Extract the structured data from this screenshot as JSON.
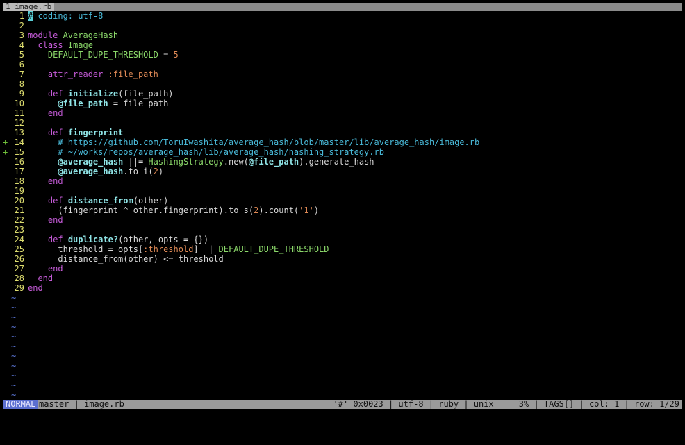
{
  "tab": {
    "label": "1 image.rb"
  },
  "lines": [
    {
      "n": "1",
      "sign": "",
      "tokens": [
        [
          "cursor",
          "#"
        ],
        [
          "t-comment",
          " coding: utf-8"
        ]
      ]
    },
    {
      "n": "2",
      "sign": "",
      "tokens": []
    },
    {
      "n": "3",
      "sign": "",
      "tokens": [
        [
          "t-keyword",
          "module "
        ],
        [
          "t-const",
          "AverageHash"
        ]
      ]
    },
    {
      "n": "4",
      "sign": "",
      "tokens": [
        [
          "t-text",
          "  "
        ],
        [
          "t-keyword",
          "class "
        ],
        [
          "t-const",
          "Image"
        ]
      ]
    },
    {
      "n": "5",
      "sign": "",
      "tokens": [
        [
          "t-text",
          "    "
        ],
        [
          "t-const",
          "DEFAULT_DUPE_THRESHOLD"
        ],
        [
          "t-text",
          " = "
        ],
        [
          "t-number",
          "5"
        ]
      ]
    },
    {
      "n": "6",
      "sign": "",
      "tokens": []
    },
    {
      "n": "7",
      "sign": "",
      "tokens": [
        [
          "t-text",
          "    "
        ],
        [
          "t-keyword",
          "attr_reader "
        ],
        [
          "t-symbol",
          ":file_path"
        ]
      ]
    },
    {
      "n": "8",
      "sign": "",
      "tokens": []
    },
    {
      "n": "9",
      "sign": "",
      "tokens": [
        [
          "t-text",
          "    "
        ],
        [
          "t-keyword",
          "def "
        ],
        [
          "t-method",
          "initialize"
        ],
        [
          "t-text",
          "(file_path)"
        ]
      ]
    },
    {
      "n": "10",
      "sign": "",
      "tokens": [
        [
          "t-text",
          "      "
        ],
        [
          "t-ivar",
          "@file_path"
        ],
        [
          "t-text",
          " = file_path"
        ]
      ]
    },
    {
      "n": "11",
      "sign": "",
      "tokens": [
        [
          "t-text",
          "    "
        ],
        [
          "t-keyword",
          "end"
        ]
      ]
    },
    {
      "n": "12",
      "sign": "",
      "tokens": []
    },
    {
      "n": "13",
      "sign": "",
      "tokens": [
        [
          "t-text",
          "    "
        ],
        [
          "t-keyword",
          "def "
        ],
        [
          "t-method",
          "fingerprint"
        ]
      ]
    },
    {
      "n": "14",
      "sign": "+",
      "tokens": [
        [
          "t-text",
          "      "
        ],
        [
          "t-comment",
          "# https://github.com/ToruIwashita/average_hash/blob/master/lib/average_hash/image.rb"
        ]
      ]
    },
    {
      "n": "15",
      "sign": "+",
      "tokens": [
        [
          "t-text",
          "      "
        ],
        [
          "t-comment",
          "# ~/works/repos/average_hash/lib/average_hash/hashing_strategy.rb"
        ]
      ]
    },
    {
      "n": "16",
      "sign": "",
      "tokens": [
        [
          "t-text",
          "      "
        ],
        [
          "t-ivar",
          "@average_hash"
        ],
        [
          "t-text",
          " ||= "
        ],
        [
          "t-const",
          "HashingStrategy"
        ],
        [
          "t-text",
          ".new("
        ],
        [
          "t-ivar",
          "@file_path"
        ],
        [
          "t-text",
          ").generate_hash"
        ]
      ]
    },
    {
      "n": "17",
      "sign": "",
      "tokens": [
        [
          "t-text",
          "      "
        ],
        [
          "t-ivar",
          "@average_hash"
        ],
        [
          "t-text",
          ".to_i("
        ],
        [
          "t-number",
          "2"
        ],
        [
          "t-text",
          ")"
        ]
      ]
    },
    {
      "n": "18",
      "sign": "",
      "tokens": [
        [
          "t-text",
          "    "
        ],
        [
          "t-keyword",
          "end"
        ]
      ]
    },
    {
      "n": "19",
      "sign": "",
      "tokens": []
    },
    {
      "n": "20",
      "sign": "",
      "tokens": [
        [
          "t-text",
          "    "
        ],
        [
          "t-keyword",
          "def "
        ],
        [
          "t-method",
          "distance_from"
        ],
        [
          "t-text",
          "(other)"
        ]
      ]
    },
    {
      "n": "21",
      "sign": "",
      "tokens": [
        [
          "t-text",
          "      (fingerprint ^ other.fingerprint).to_s("
        ],
        [
          "t-number",
          "2"
        ],
        [
          "t-text",
          ").count("
        ],
        [
          "t-string",
          "'1'"
        ],
        [
          "t-text",
          ")"
        ]
      ]
    },
    {
      "n": "22",
      "sign": "",
      "tokens": [
        [
          "t-text",
          "    "
        ],
        [
          "t-keyword",
          "end"
        ]
      ]
    },
    {
      "n": "23",
      "sign": "",
      "tokens": []
    },
    {
      "n": "24",
      "sign": "",
      "tokens": [
        [
          "t-text",
          "    "
        ],
        [
          "t-keyword",
          "def "
        ],
        [
          "t-method",
          "duplicate?"
        ],
        [
          "t-text",
          "(other, opts = {})"
        ]
      ]
    },
    {
      "n": "25",
      "sign": "",
      "tokens": [
        [
          "t-text",
          "      threshold = opts["
        ],
        [
          "t-symbol",
          ":threshold"
        ],
        [
          "t-text",
          "] || "
        ],
        [
          "t-const",
          "DEFAULT_DUPE_THRESHOLD"
        ]
      ]
    },
    {
      "n": "26",
      "sign": "",
      "tokens": [
        [
          "t-text",
          "      distance_from(other) <= threshold"
        ]
      ]
    },
    {
      "n": "27",
      "sign": "",
      "tokens": [
        [
          "t-text",
          "    "
        ],
        [
          "t-keyword",
          "end"
        ]
      ]
    },
    {
      "n": "28",
      "sign": "",
      "tokens": [
        [
          "t-text",
          "  "
        ],
        [
          "t-keyword",
          "end"
        ]
      ]
    },
    {
      "n": "29",
      "sign": "",
      "tokens": [
        [
          "t-keyword",
          "end"
        ]
      ]
    }
  ],
  "tilde_count": 12,
  "tilde_char": "~",
  "status": {
    "mode": "NORMAL",
    "left": "master | image.rb",
    "right": "'#' 0x0023 | utf-8 | ruby | unix     3% | TAGS[] | col: 1 | row: 1/29"
  }
}
